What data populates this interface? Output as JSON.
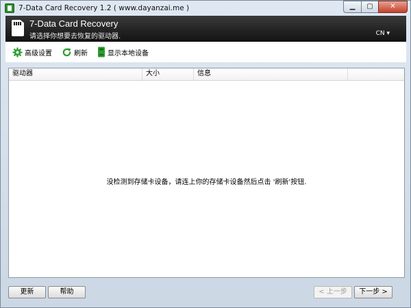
{
  "window": {
    "title": "7-Data Card Recovery 1.2 ( www.dayanzai.me )",
    "controls": {
      "minimize": "▁",
      "maximize": "▢",
      "close": "✕"
    }
  },
  "header": {
    "title": "7-Data Card Recovery",
    "subtitle": "请选择你想要去恢复的驱动器.",
    "language": "CN ▾"
  },
  "toolbar": {
    "items": [
      {
        "label": "高级设置",
        "icon": "gear-icon"
      },
      {
        "label": "刷新",
        "icon": "refresh-icon"
      },
      {
        "label": "显示本地设备",
        "icon": "device-icon"
      }
    ]
  },
  "drive_list": {
    "columns": [
      "驱动器",
      "大小",
      "信息",
      ""
    ],
    "empty_message": "没检测到存储卡设备，请连上你的存储卡设备然后点击 '刷新'按钮."
  },
  "buttons": {
    "update": "更新",
    "help": "帮助",
    "prev": "< 上一步",
    "next": "下一步 >"
  },
  "colors": {
    "accent_green": "#2e9e2e",
    "header_bg": "#1a1a1a",
    "window_chrome": "#cbd7e4"
  }
}
